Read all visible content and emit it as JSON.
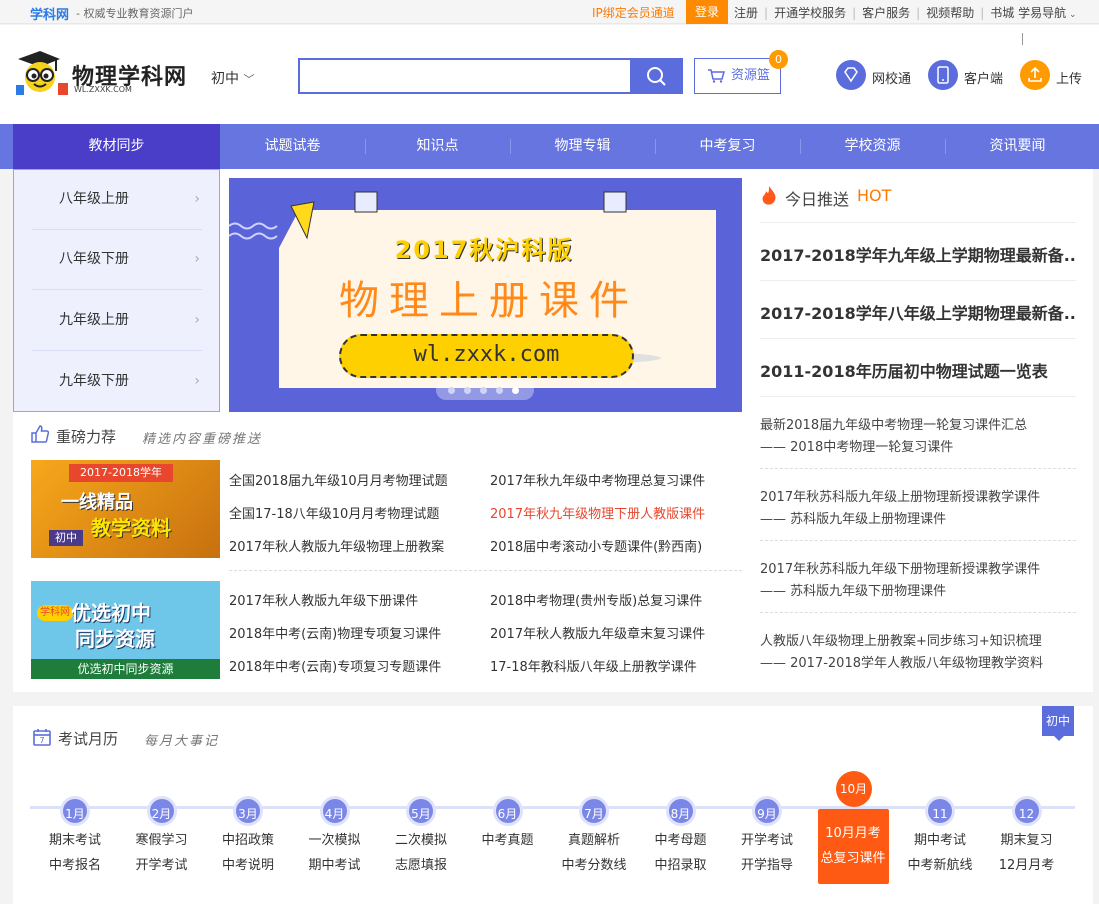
{
  "topbar": {
    "brand": "学科网",
    "tagline": "- 权威专业教育资源门户",
    "ip_binding": "IP绑定会员通道",
    "login": "登录",
    "links": [
      "注册",
      "开通学校服务",
      "客户服务",
      "视频帮助",
      "书城",
      "学易导航"
    ]
  },
  "header": {
    "logo_title": "物理学科网",
    "logo_url": "WL.ZXXK.COM",
    "level": "初中",
    "search_placeholder": "",
    "basket_label": "资源篮",
    "basket_count": "0",
    "actions": [
      {
        "label": "网校通",
        "icon": "diamond-icon",
        "color": "#5b6ddd"
      },
      {
        "label": "客户端",
        "icon": "tablet-icon",
        "color": "#5b6ddd"
      },
      {
        "label": "上传",
        "icon": "upload-icon",
        "color": "#ff9a00"
      }
    ]
  },
  "nav": {
    "items": [
      "教材同步",
      "试题试卷",
      "知识点",
      "物理专辑",
      "中考复习",
      "学校资源",
      "资讯要闻"
    ],
    "active_index": 0
  },
  "side_menu": [
    "八年级上册",
    "八年级下册",
    "九年级上册",
    "九年级下册"
  ],
  "banner": {
    "title": "2017秋沪科版",
    "main": "物理上册课件",
    "url": "wl.zxxk.com",
    "dots_count": 5,
    "active_dot": 4
  },
  "today": {
    "title": "今日推送",
    "hot": "HOT",
    "headlines": [
      "2017-2018学年九年级上学期物理最新备...",
      "2017-2018学年八年级上学期物理最新备...",
      "2011-2018年历届初中物理试题一览表"
    ],
    "items": [
      {
        "line1": "最新2018届九年级中考物理一轮复习课件汇总",
        "line2": "—— 2018中考物理一轮复习课件"
      },
      {
        "line1": "2017年秋苏科版九年级上册物理新授课教学课件",
        "line2": "—— 苏科版九年级上册物理课件"
      },
      {
        "line1": "2017年秋苏科版九年级下册物理新授课教学课件",
        "line2": "—— 苏科版九年级下册物理课件"
      },
      {
        "line1": "人教版八年级物理上册教案+同步练习+知识梳理",
        "line2": "—— 2017-2018学年人教版八年级物理教学资料"
      }
    ]
  },
  "recommend": {
    "title": "重磅力荐",
    "subtitle": "精选内容重磅推送",
    "banner1": {
      "year": "2017-2018学年",
      "line1": "一线精品",
      "line2": "教学资料",
      "tag": "初中"
    },
    "banner2": {
      "brand": "学科网",
      "line1": "优选初中",
      "line2": "同步资源",
      "caption": "优选初中同步资源"
    },
    "group1": [
      [
        "全国2018届九年级10月月考物理试题",
        "2017年秋九年级中考物理总复习课件"
      ],
      [
        "全国17-18八年级10月月考物理试题",
        "2017年秋九年级物理下册人教版课件"
      ],
      [
        "2017年秋人教版九年级物理上册教案",
        "2018届中考滚动小专题课件(黔西南)"
      ]
    ],
    "group2": [
      [
        "2017年秋人教版九年级下册课件",
        "2018中考物理(贵州专版)总复习课件"
      ],
      [
        "2018年中考(云南)物理专项复习课件",
        "2017年秋人教版九年级章末复习课件"
      ],
      [
        "2018年中考(云南)专项复习专题课件",
        "17-18年教科版八年级上册教学课件"
      ]
    ],
    "highlight": "2017年秋九年级物理下册人教版课件"
  },
  "calendar": {
    "title": "考试月历",
    "subtitle": "每月大事记",
    "badge": "初中",
    "months": [
      {
        "label": "1月",
        "events": [
          "期末考试",
          "中考报名"
        ]
      },
      {
        "label": "2月",
        "events": [
          "寒假学习",
          "开学考试"
        ]
      },
      {
        "label": "3月",
        "events": [
          "中招政策",
          "中考说明"
        ]
      },
      {
        "label": "4月",
        "events": [
          "一次模拟",
          "期中考试"
        ]
      },
      {
        "label": "5月",
        "events": [
          "二次模拟",
          "志愿填报"
        ]
      },
      {
        "label": "6月",
        "events": [
          "中考真题",
          ""
        ]
      },
      {
        "label": "7月",
        "events": [
          "真题解析",
          "中考分数线"
        ]
      },
      {
        "label": "8月",
        "events": [
          "中考母题",
          "中招录取"
        ]
      },
      {
        "label": "9月",
        "events": [
          "开学考试",
          "开学指导"
        ]
      },
      {
        "label": "10月",
        "events": [
          "10月月考",
          "总复习课件"
        ]
      },
      {
        "label": "11月",
        "events": [
          "期中考试",
          "中考新航线"
        ]
      },
      {
        "label": "12月",
        "events": [
          "期末复习",
          "12月月考"
        ]
      }
    ],
    "current_index": 9
  }
}
